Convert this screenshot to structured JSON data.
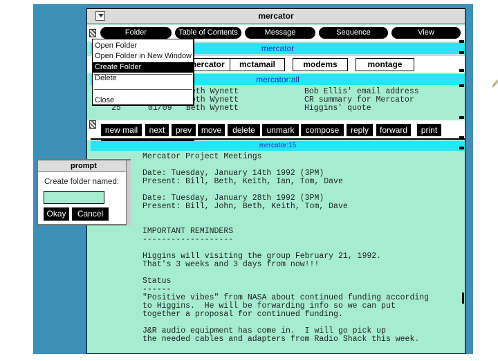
{
  "window": {
    "title": "mercator"
  },
  "menubar": [
    "Folder",
    "Table of Contents",
    "Message",
    "Sequence",
    "View"
  ],
  "folder_bar": {
    "label": "mercator"
  },
  "mailboxes": [
    "mercator",
    "mctamail",
    "modems",
    "montage"
  ],
  "folder_all_bar": {
    "label": "mercator:all"
  },
  "messages": [
    {
      "num": "",
      "date": "",
      "from": "eth Wynett",
      "subject": "Bob Ellis' email address"
    },
    {
      "num": "",
      "date": "",
      "from": "eth Wynett",
      "subject": "CR summary for Mercator"
    },
    {
      "num": "25",
      "date": "01/09",
      "from": "Beth Wynett",
      "subject": "Higgins' quote"
    }
  ],
  "toolbar": [
    "new mail",
    "next",
    "prev",
    "move",
    "delete",
    "unmark",
    "compose",
    "reply",
    "forward",
    "print"
  ],
  "message_bar": {
    "label": "mercator:15"
  },
  "message_body": [
    "Mercator Project Meetings",
    "",
    "Date: Tuesday, January 14th 1992 (3PM)",
    "Present: Bill, Beth, Keith, Ian, Tom, Dave",
    "",
    "Date: Tuesday, January 28th 1992 (3PM)",
    "Present: Bill, John, Beth, Keith, Tom, Dave",
    "",
    "",
    "IMPORTANT REMINDERS",
    "-------------------",
    "",
    "Higgins will visiting the group February 21, 1992.",
    "That's 3 weeks and 3 days from now!!!",
    "",
    "Status",
    "------",
    "\"Positive vibes\" from NASA about continued funding according",
    "to Higgins.  He will be forwarding info so we can put",
    "together a proposal for continued funding.",
    "",
    "J&R audio equipment has come in.  I will go pick up",
    "the needed cables and adapters from Radio Shack this week."
  ],
  "dropdown": {
    "items": [
      "Open Folder",
      "Open Folder in New Window",
      "Create Folder",
      "Delete",
      "Close"
    ],
    "selected": "Create Folder"
  },
  "prompt": {
    "title": "prompt",
    "label": "Create folder named:",
    "value": "",
    "ok": "Okay",
    "cancel": "Cancel"
  }
}
